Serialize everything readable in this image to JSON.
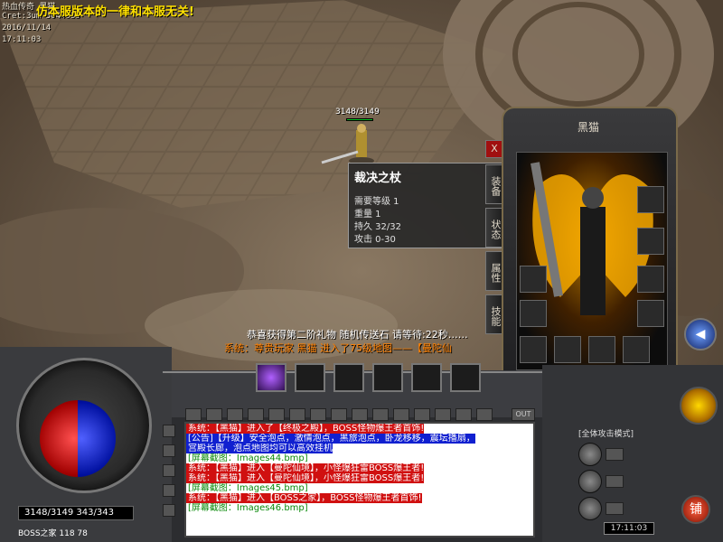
{
  "game": {
    "title_overlay": "热血传奇 黑猫",
    "user_line": "Cret:3um 5644933",
    "date": "2016/11/14",
    "time": "17:11:03",
    "banner": "仿本服版本的一律和本服无关!"
  },
  "player": {
    "hp_label": "3148/3149"
  },
  "announcements": {
    "gift": "恭喜获得第二阶礼物  随机传送石  请等待:22秒……",
    "system": "系统：尊贵玩家 黑猫 进入了75级地图——【曼陀仙"
  },
  "character_panel": {
    "title": "黑猫",
    "tabs": [
      "装备",
      "状态",
      "属性",
      "技能"
    ],
    "close": "X"
  },
  "tooltip": {
    "item_name": "裁决之杖",
    "lines": [
      "需要等级 1",
      "重量 1",
      "持久 32/32",
      "攻击 0-30"
    ]
  },
  "chat": {
    "lines": [
      {
        "type": "red",
        "text": "系统：【黑猫】进入了【终极之殿】，BOSS怪物爆王者首饰!"
      },
      {
        "type": "blue",
        "text": "[公告]【升级】安全泡点，激情泡点，黑旅泡点，卧龙移移，震坛播扇，"
      },
      {
        "type": "blue",
        "text": "宫殿长廊，泡点地图均可以高效挂机"
      },
      {
        "type": "link",
        "text": "[屏幕截图：Images44.bmp]"
      },
      {
        "type": "red",
        "text": "系统：【黑猫】进入【曼陀仙境】，小怪爆狂雷BOSS爆王者!"
      },
      {
        "type": "red",
        "text": "系统：【黑猫】进入【曼陀仙境】，小怪爆狂雷BOSS爆王者!"
      },
      {
        "type": "link",
        "text": "[屏幕截图：Images45.bmp]"
      },
      {
        "type": "red",
        "text": "系统：【黑猫】进入【BOSS之家】，BOSS怪物爆王者首饰!"
      },
      {
        "type": "link",
        "text": "[屏幕截图：Images46.bmp]"
      }
    ]
  },
  "hud": {
    "stats": "3148/3149  343/343",
    "map": "BOSS之家 118 78",
    "clock": "17:11:03",
    "attack_mode": "[全体攻击模式]",
    "shop": "铺",
    "out": "OUT"
  },
  "colors": {
    "hp": "#d01010",
    "mp": "#1020d0",
    "banner": "#ffe000",
    "link": "#0a8a0a"
  }
}
